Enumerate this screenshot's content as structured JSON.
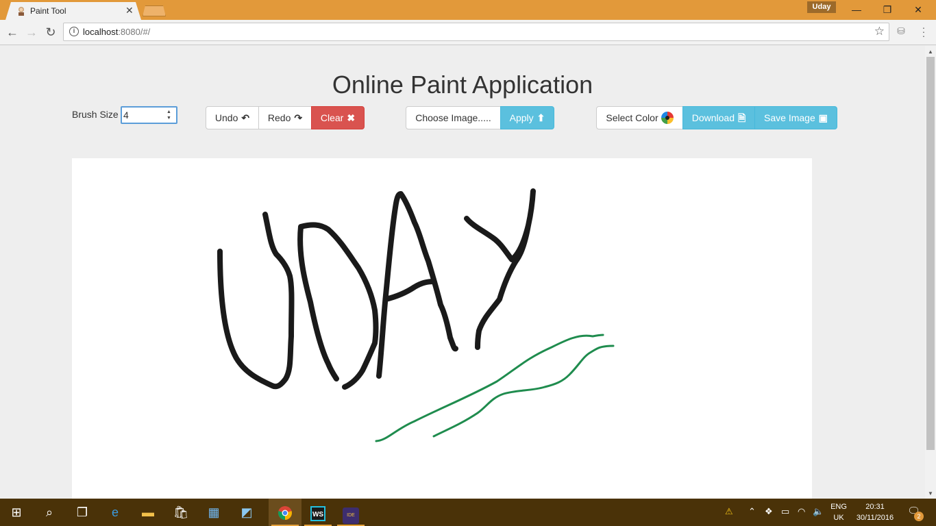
{
  "browser": {
    "tab_title": "Paint Tool",
    "tab_close": "✕",
    "profile_name": "Uday",
    "url_host": "localhost",
    "url_rest": ":8080/#/",
    "window_controls": {
      "minimize": "—",
      "restore": "❐",
      "close": "✕"
    }
  },
  "page": {
    "title": "Online Paint Application",
    "brush_label": "Brush Size",
    "brush_value": "4",
    "buttons": {
      "undo": "Undo",
      "redo": "Redo",
      "clear": "Clear",
      "choose_image": "Choose Image.....",
      "apply": "Apply",
      "select_color": "Select Color",
      "download": "Download",
      "save_image": "Save Image"
    },
    "icons": {
      "undo": "undo-arrow-icon",
      "redo": "redo-arrow-icon",
      "clear": "times-icon",
      "apply": "upload-icon",
      "select_color": "color-wheel-icon",
      "download": "file-download-icon",
      "save_image": "picture-icon"
    },
    "stroke_colors": {
      "black": "#1a1a1a",
      "green": "#1f8c4e"
    }
  },
  "taskbar": {
    "language_top": "ENG",
    "language_bottom": "UK",
    "time": "20:31",
    "date": "30/11/2016",
    "notifications": "2"
  }
}
